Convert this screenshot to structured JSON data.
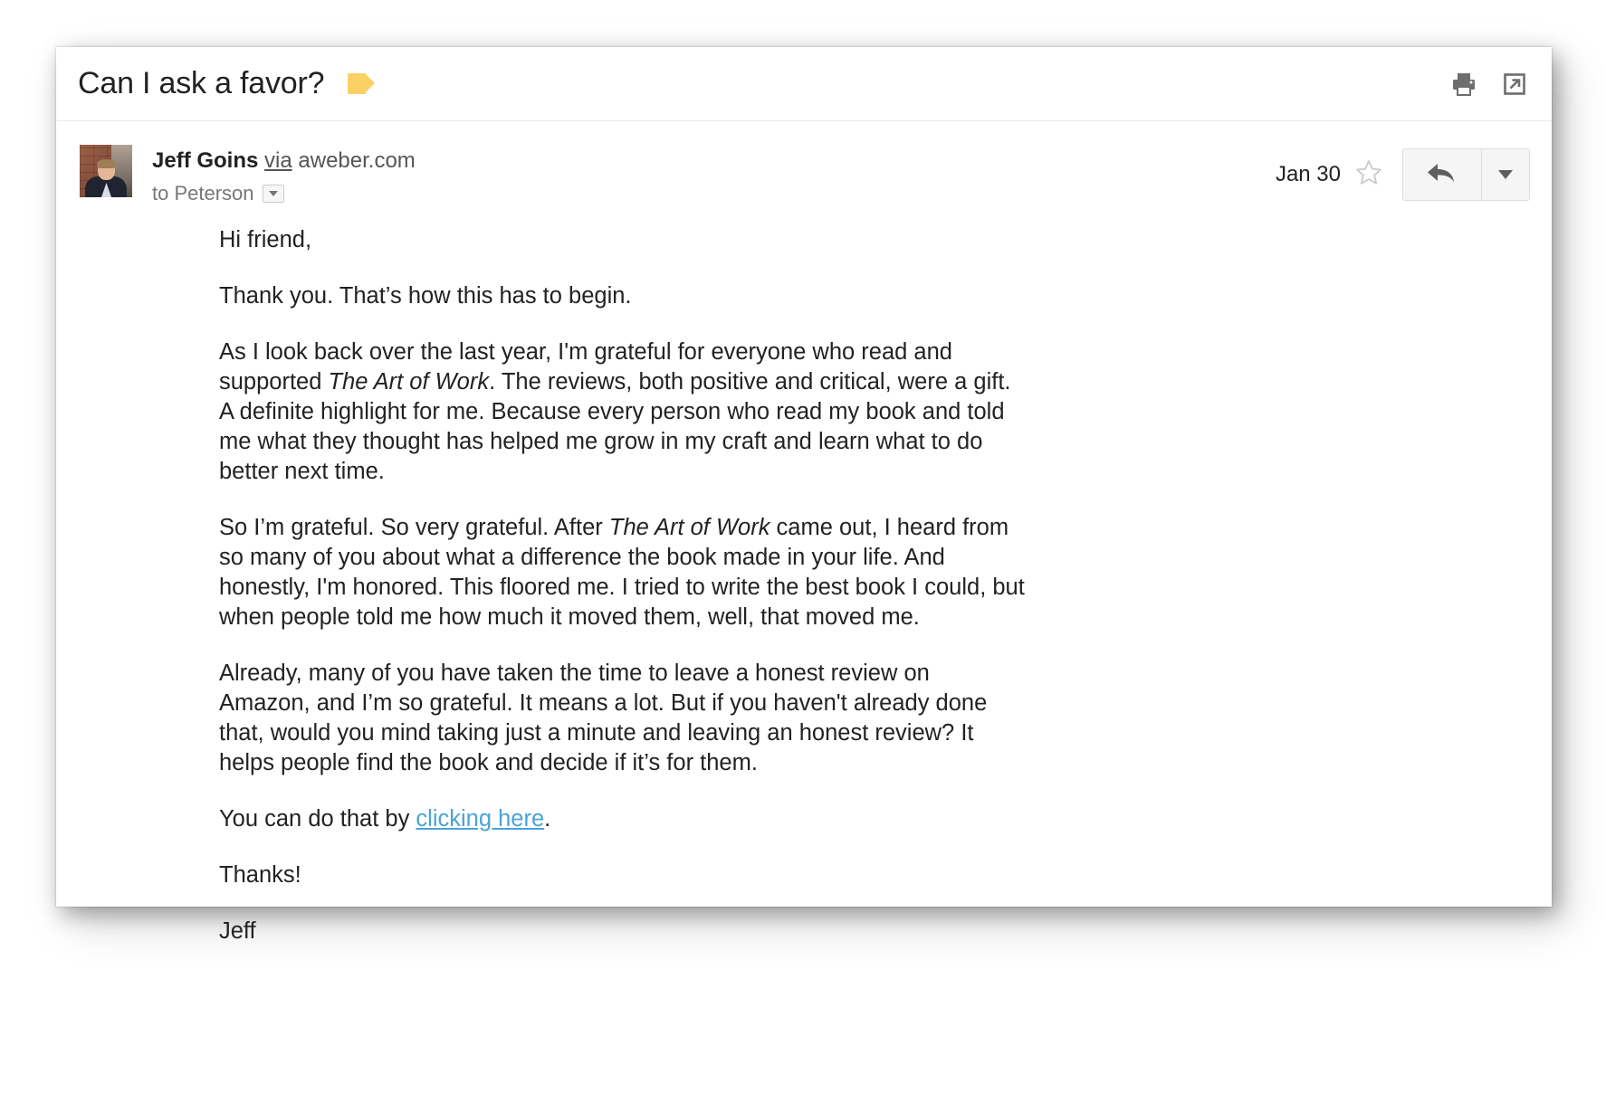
{
  "header": {
    "subject": "Can I ask a favor?",
    "label_color": "#fbd065",
    "print_icon": "printer-icon",
    "popout_icon": "open-in-new-window-icon"
  },
  "sender": {
    "name": "Jeff Goins",
    "via": "via",
    "domain": "aweber.com",
    "recipient": "to Peterson",
    "date": "Jan 30",
    "star_icon": "star-outline-icon",
    "reply_icon": "reply-arrow-icon",
    "more_icon": "chevron-down-icon"
  },
  "body": {
    "greeting": "Hi friend,",
    "p1": "Thank you. That’s how this has to begin.",
    "p2_a": "As I look back over the last year, I'm grateful for everyone who read and supported ",
    "p2_title": "The Art of Work",
    "p2_b": ". The reviews, both positive and critical, were a gift. A definite highlight for me. Because every person who read my book and told me what they thought has helped me grow in my craft and learn what to do better next time.",
    "p3_a": "So I’m grateful. So very grateful. After ",
    "p3_title": "The Art of Work",
    "p3_b": " came out, I heard from so many of you about what a difference the book made in your life. And honestly, I'm honored. This floored me. I tried to write the best book I could, but when people told me how much it moved them, well, that moved me.",
    "p4": "Already, many of you have taken the time to leave a honest review on Amazon, and I’m so grateful. It means a lot. But if you haven't already done that, would you mind taking just a minute and leaving an honest review? It helps people find the book and decide if it’s for them.",
    "p5_a": "You can do that by ",
    "p5_link": "clicking here",
    "p5_b": ".",
    "p6": "Thanks!",
    "p7": "Jeff",
    "link_color": "#4aa3d8"
  }
}
